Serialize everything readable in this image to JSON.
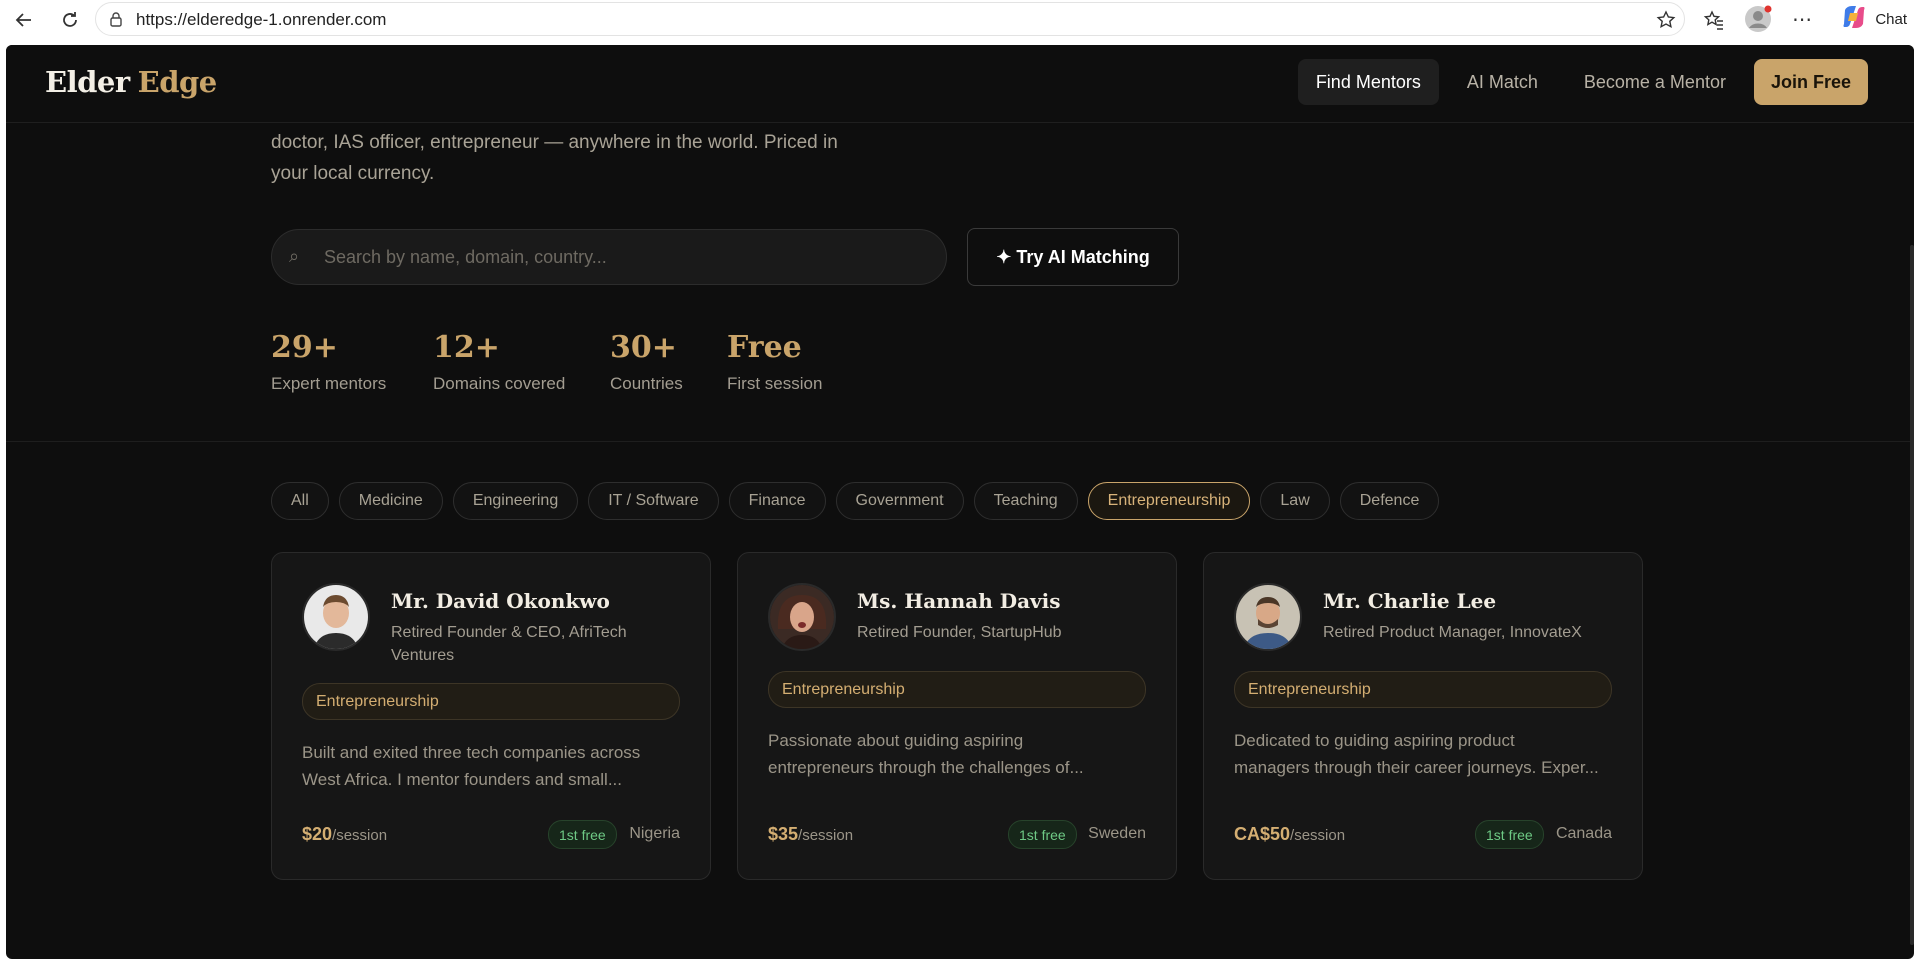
{
  "browser": {
    "url": "https://elderedge-1.onrender.com",
    "chat_label": "Chat"
  },
  "header": {
    "logo_part1": "Elder",
    "logo_part2": "Edge",
    "nav": [
      {
        "label": "Find Mentors",
        "active": true
      },
      {
        "label": "AI Match",
        "active": false
      },
      {
        "label": "Become a Mentor",
        "active": false
      }
    ],
    "join_label": "Join Free"
  },
  "hero": {
    "intro_line1": "doctor, IAS officer, entrepreneur — anywhere in the world. Priced in",
    "intro_line2": "your local currency.",
    "search_placeholder": "Search by name, domain, country...",
    "search_icon": "⌕",
    "ai_button": "✦ Try AI Matching"
  },
  "stats": [
    {
      "value": "29+",
      "label": "Expert mentors"
    },
    {
      "value": "12+",
      "label": "Domains covered"
    },
    {
      "value": "30+",
      "label": "Countries"
    },
    {
      "value": "Free",
      "label": "First session"
    }
  ],
  "filters": [
    {
      "label": "All",
      "active": false
    },
    {
      "label": "Medicine",
      "active": false
    },
    {
      "label": "Engineering",
      "active": false
    },
    {
      "label": "IT / Software",
      "active": false
    },
    {
      "label": "Finance",
      "active": false
    },
    {
      "label": "Government",
      "active": false
    },
    {
      "label": "Teaching",
      "active": false
    },
    {
      "label": "Entrepreneurship",
      "active": true
    },
    {
      "label": "Law",
      "active": false
    },
    {
      "label": "Defence",
      "active": false
    }
  ],
  "mentors": [
    {
      "name": "Mr. David Okonkwo",
      "role": "Retired Founder & CEO, AfriTech Ventures",
      "tag": "Entrepreneurship",
      "bio_line1": "Built and exited three tech companies across",
      "bio_line2": "West Africa. I mentor founders and small...",
      "price": "$20",
      "price_unit": "/session",
      "free_label": "1st free",
      "country": "Nigeria"
    },
    {
      "name": "Ms. Hannah Davis",
      "role": "Retired Founder, StartupHub",
      "tag": "Entrepreneurship",
      "bio_line1": "Passionate about guiding aspiring",
      "bio_line2": "entrepreneurs through the challenges of...",
      "price": "$35",
      "price_unit": "/session",
      "free_label": "1st free",
      "country": "Sweden"
    },
    {
      "name": "Mr. Charlie Lee",
      "role": "Retired Product Manager, InnovateX",
      "tag": "Entrepreneurship",
      "bio_line1": "Dedicated to guiding aspiring product",
      "bio_line2": "managers through their career journeys. Exper...",
      "price": "CA$50",
      "price_unit": "/session",
      "free_label": "1st free",
      "country": "Canada"
    }
  ],
  "colors": {
    "background": "#0e0e0e",
    "gold": "#c9a46a",
    "card": "#161616",
    "free_green": "#6ec985"
  }
}
